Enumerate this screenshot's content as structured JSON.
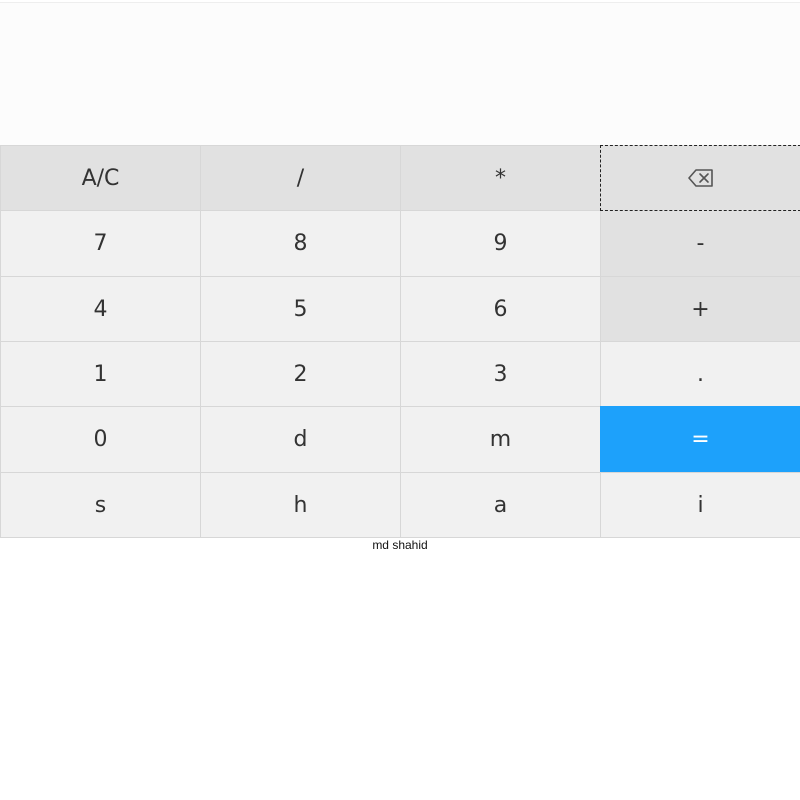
{
  "display": {
    "value": ""
  },
  "keypad": {
    "rows": [
      [
        {
          "label": "A/C",
          "name": "clear-button",
          "style": "op"
        },
        {
          "label": "/",
          "name": "divide-button",
          "style": "op"
        },
        {
          "label": "*",
          "name": "multiply-button",
          "style": "op"
        },
        {
          "label": "",
          "name": "backspace-button",
          "style": "op",
          "icon": "backspace-icon",
          "focused": true
        }
      ],
      [
        {
          "label": "7",
          "name": "digit-7-button",
          "style": "num"
        },
        {
          "label": "8",
          "name": "digit-8-button",
          "style": "num"
        },
        {
          "label": "9",
          "name": "digit-9-button",
          "style": "num"
        },
        {
          "label": "-",
          "name": "subtract-button",
          "style": "op"
        }
      ],
      [
        {
          "label": "4",
          "name": "digit-4-button",
          "style": "num"
        },
        {
          "label": "5",
          "name": "digit-5-button",
          "style": "num"
        },
        {
          "label": "6",
          "name": "digit-6-button",
          "style": "num"
        },
        {
          "label": "+",
          "name": "add-button",
          "style": "op"
        }
      ],
      [
        {
          "label": "1",
          "name": "digit-1-button",
          "style": "num"
        },
        {
          "label": "2",
          "name": "digit-2-button",
          "style": "num"
        },
        {
          "label": "3",
          "name": "digit-3-button",
          "style": "num"
        },
        {
          "label": ".",
          "name": "decimal-button",
          "style": "num"
        }
      ],
      [
        {
          "label": "0",
          "name": "digit-0-button",
          "style": "num"
        },
        {
          "label": "d",
          "name": "letter-d-button",
          "style": "num"
        },
        {
          "label": "m",
          "name": "letter-m-button",
          "style": "num"
        },
        {
          "label": "=",
          "name": "equals-button",
          "style": "equals"
        }
      ],
      [
        {
          "label": "s",
          "name": "letter-s-button",
          "style": "num"
        },
        {
          "label": "h",
          "name": "letter-h-button",
          "style": "num"
        },
        {
          "label": "a",
          "name": "letter-a-button",
          "style": "num"
        },
        {
          "label": "i",
          "name": "letter-i-button",
          "style": "num"
        }
      ]
    ]
  },
  "colors": {
    "equals_accent": "#1da1fb",
    "operator_key": "#e1e1e1",
    "number_key": "#f1f1f1"
  },
  "footer": {
    "credit": "md shahid"
  }
}
